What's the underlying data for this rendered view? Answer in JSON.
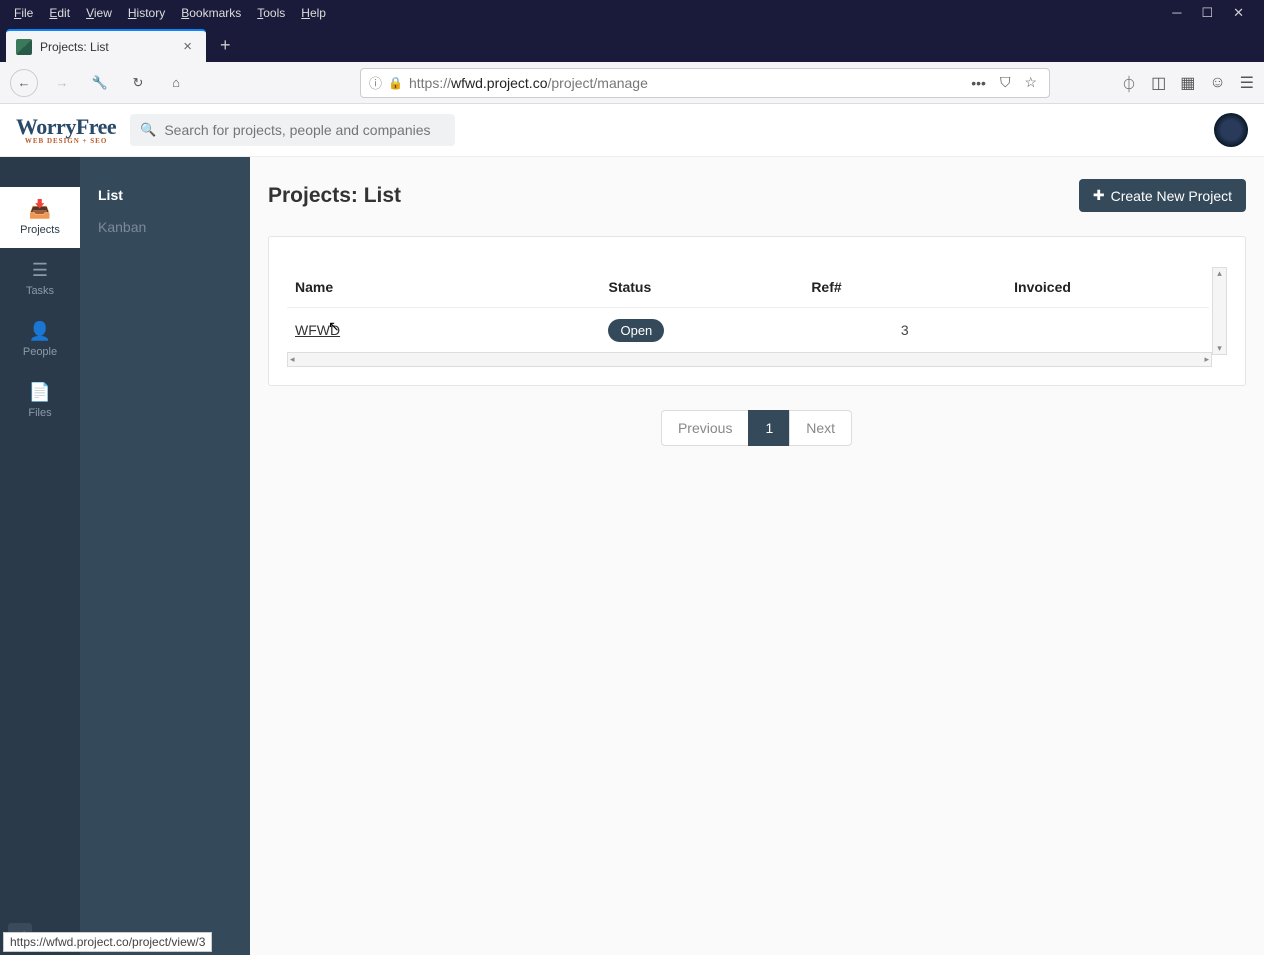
{
  "browser": {
    "menus": [
      "File",
      "Edit",
      "View",
      "History",
      "Bookmarks",
      "Tools",
      "Help"
    ],
    "tab_title": "Projects: List",
    "url_proto": "https://",
    "url_domain": "wfwd.project.co",
    "url_path": "/project/manage",
    "status_bar": "https://wfwd.project.co/project/view/3"
  },
  "logo": {
    "main": "WorryFree",
    "sub": "WEB DESIGN + SEO"
  },
  "search": {
    "placeholder": "Search for projects, people and companies"
  },
  "nav_rail": {
    "items": [
      {
        "icon": "inbox",
        "label": "Projects"
      },
      {
        "icon": "list",
        "label": "Tasks"
      },
      {
        "icon": "user",
        "label": "People"
      },
      {
        "icon": "file",
        "label": "Files"
      }
    ]
  },
  "sub_nav": {
    "items": [
      "List",
      "Kanban"
    ]
  },
  "page": {
    "title": "Projects: List",
    "create_btn": "Create New Project"
  },
  "table": {
    "headers": [
      "Name",
      "Status",
      "Ref#",
      "Invoiced"
    ],
    "rows": [
      {
        "name": "WFWD",
        "status": "Open",
        "ref": "3",
        "invoiced": ""
      }
    ]
  },
  "pagination": {
    "prev": "Previous",
    "pages": [
      "1"
    ],
    "next": "Next"
  }
}
